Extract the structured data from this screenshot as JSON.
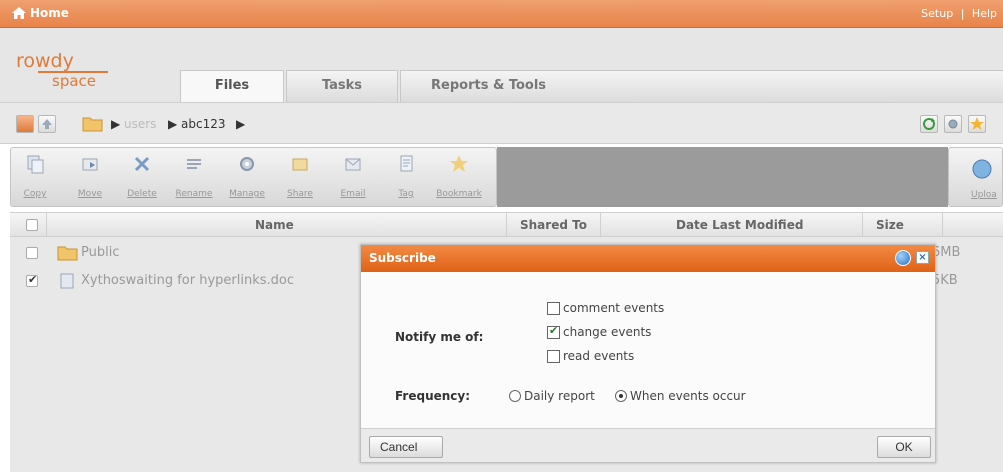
{
  "topbar": {
    "home_label": "Home",
    "setup_label": "Setup",
    "separator": "|",
    "help_label": "Help"
  },
  "logo": {
    "line1": "rowdy",
    "line2": "space"
  },
  "tabs": [
    {
      "label": "Files",
      "active": true
    },
    {
      "label": "Tasks",
      "active": false
    },
    {
      "label": "Reports & Tools",
      "active": false
    }
  ],
  "breadcrumb": {
    "items": [
      "users",
      "abc123"
    ]
  },
  "toolbar": {
    "buttons": [
      {
        "label": "Copy",
        "icon": "copy-icon"
      },
      {
        "label": "Move",
        "icon": "move-icon"
      },
      {
        "label": "Delete",
        "icon": "delete-icon"
      },
      {
        "label": "Rename",
        "icon": "rename-icon"
      },
      {
        "label": "Manage",
        "icon": "gear-icon"
      },
      {
        "label": "Share",
        "icon": "share-icon"
      },
      {
        "label": "Email",
        "icon": "email-icon"
      },
      {
        "label": "Tag",
        "icon": "tag-icon"
      },
      {
        "label": "Bookmark",
        "icon": "star-icon"
      }
    ],
    "upload_label": "Uploa"
  },
  "table": {
    "headers": {
      "name": "Name",
      "shared_to": "Shared To",
      "date_last_modified": "Date Last Modified",
      "size": "Size"
    },
    "rows": [
      {
        "name": "Public",
        "size": "6MB",
        "checked": false
      },
      {
        "name": "Xythoswaiting for hyperlinks.doc",
        "size": "5KB",
        "checked": true
      }
    ]
  },
  "dialog": {
    "title": "Subscribe",
    "notify_label": "Notify me of:",
    "events": [
      {
        "label": "comment events",
        "checked": false
      },
      {
        "label": "change events",
        "checked": true
      },
      {
        "label": "read events",
        "checked": false
      }
    ],
    "frequency_label": "Frequency:",
    "frequency_options": [
      {
        "label": "Daily report",
        "selected": false
      },
      {
        "label": "When events occur",
        "selected": true
      }
    ],
    "cancel_label": "Cancel",
    "ok_label": "OK"
  },
  "colors": {
    "accent": "#e06216",
    "topbar": "#e8834a",
    "logo": "#e07a3a"
  }
}
